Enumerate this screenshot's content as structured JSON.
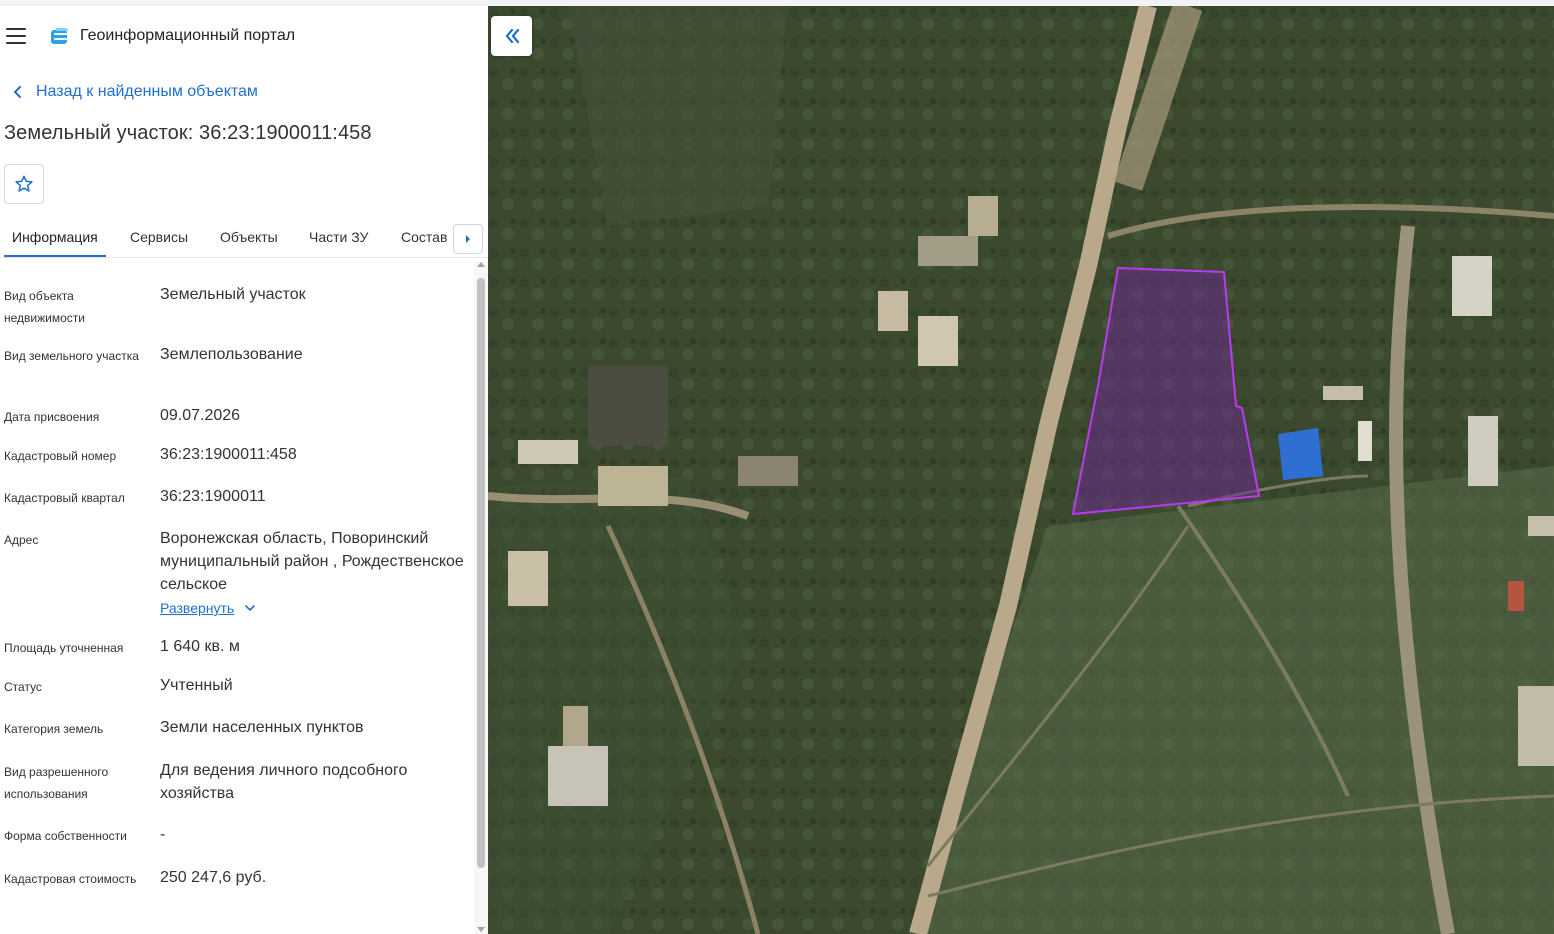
{
  "header": {
    "portal_title": "Геоинформационный портал"
  },
  "navigation": {
    "back_label": "Назад к найденным объектам"
  },
  "object": {
    "title": "Земельный участок: 36:23:1900011:458"
  },
  "tabs": [
    {
      "label": "Информация",
      "active": true
    },
    {
      "label": "Сервисы",
      "active": false
    },
    {
      "label": "Объекты",
      "active": false
    },
    {
      "label": "Части ЗУ",
      "active": false
    },
    {
      "label": "Состав",
      "active": false
    }
  ],
  "properties": [
    {
      "label": "Вид объекта недвижимости",
      "value": "Земельный участок"
    },
    {
      "label": "Вид земельного участка",
      "value": "Землепользование"
    },
    {
      "label": "Дата присвоения",
      "value": "09.07.2026"
    },
    {
      "label": "Кадастровый номер",
      "value": "36:23:1900011:458"
    },
    {
      "label": "Кадастровый квартал",
      "value": "36:23:1900011"
    },
    {
      "label": "Адрес",
      "value": "Воронежская область, Поворинский муниципальный район , Рождественское сельское"
    },
    {
      "label": "Площадь уточненная",
      "value": "1 640 кв. м"
    },
    {
      "label": "Статус",
      "value": "Учтенный"
    },
    {
      "label": "Категория земель",
      "value": "Земли населенных пунктов"
    },
    {
      "label": "Вид разрешенного использования",
      "value": "Для ведения личного подсобного хозяйства"
    },
    {
      "label": "Форма собственности",
      "value": "-"
    },
    {
      "label": "Кадастровая стоимость",
      "value": "250 247,6 руб."
    }
  ],
  "address_expand_label": "Развернуть",
  "map": {
    "parcel_color": "#9b30d9",
    "collapse_icon": "double-chevron-left-icon"
  },
  "colors": {
    "accent": "#1f6fce"
  }
}
